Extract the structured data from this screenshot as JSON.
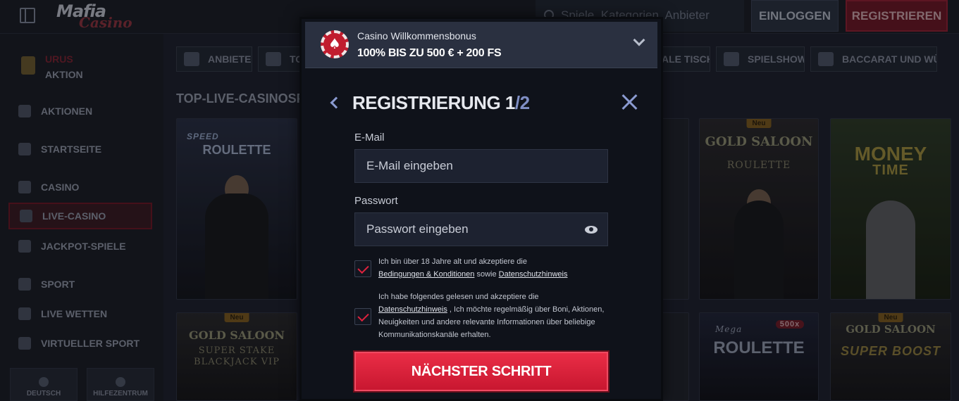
{
  "header": {
    "logo_text": "Mafia",
    "logo_script": "Casino",
    "search_placeholder": "Spiele, Kategorien, Anbieter",
    "login_label": "EINLOGGEN",
    "register_label": "REGISTRIEREN"
  },
  "sidebar": {
    "promo": {
      "title": "URUS",
      "subtitle": "AKTION"
    },
    "items": [
      {
        "label": "AKTIONEN",
        "icon": "gift-icon"
      },
      {
        "label": "STARTSEITE",
        "icon": "home-icon"
      },
      {
        "label": "CASINO",
        "icon": "club-icon"
      },
      {
        "label": "LIVE-CASINO",
        "icon": "cards-icon",
        "active": true
      },
      {
        "label": "JACKPOT-SPIELE",
        "icon": "clover-icon"
      },
      {
        "label": "SPORT",
        "icon": "ball-icon"
      },
      {
        "label": "LIVE WETTEN",
        "icon": "live-icon"
      },
      {
        "label": "VIRTUELLER SPORT",
        "icon": "monitor-icon"
      }
    ],
    "footer": [
      {
        "label": "DEUTSCH",
        "icon": "flag-icon"
      },
      {
        "label": "HILFEZENTRUM",
        "icon": "help-icon"
      }
    ]
  },
  "categories": [
    {
      "label": "ANBIETER",
      "icon": "provider-icon"
    },
    {
      "label": "TO",
      "icon": "chip-icon"
    },
    {
      "label": "ALE TISCHE"
    },
    {
      "label": "SPIELSHOWS",
      "icon": "microphone-icon"
    },
    {
      "label": "BACCARAT UND WÜRFE",
      "icon": "dice-icon"
    }
  ],
  "section_title": "TOP-LIVE-CASINOSPIE",
  "tiles": [
    {
      "title": "ROULETTE",
      "sub": "SPEED"
    },
    {
      "badge": "Neu",
      "title": "GOLD SALOON",
      "sub": "ROULETTE"
    },
    {
      "title": "MONEY",
      "sub": "TIME"
    },
    {
      "badge": "Neu",
      "title": "GOLD SALOON",
      "sub": "SUPER STAKE BLACKJACK VIP"
    },
    {
      "title": "ROULETTE",
      "sub": "Mega",
      "extra": "500x"
    },
    {
      "badge": "Neu",
      "title": "GOLD SALOON",
      "sub": "SUPER BOOST"
    }
  ],
  "modal": {
    "bonus_title": "Casino Willkommensbonus",
    "bonus_offer": "100% BIS ZU 500 € + 200 FS",
    "title": "REGISTRIERUNG",
    "step_current": "1",
    "step_sep": "/",
    "step_total": "2",
    "email_label": "E-Mail",
    "email_placeholder": "E-Mail eingeben",
    "password_label": "Passwort",
    "password_placeholder": "Passwort eingeben",
    "consent1_text": "Ich bin über 18 Jahre alt und akzeptiere die",
    "consent1_link1": "Bedingungen & Konditionen",
    "consent1_mid": "sowie",
    "consent1_link2": "Datenschutzhinweis",
    "consent2_text": "Ich habe folgendes gelesen und akzeptiere die",
    "consent2_link": "Datenschutzhinweis",
    "consent2_rest": ", Ich möchte regelmäßig über Boni, Aktionen, Neuigkeiten und andere relevante Informationen über beliebige Kommunikationskanäle erhalten.",
    "next_label": "NÄCHSTER SCHRITT"
  },
  "colors": {
    "accent_red": "#e0223e",
    "background": "#1f2330"
  }
}
